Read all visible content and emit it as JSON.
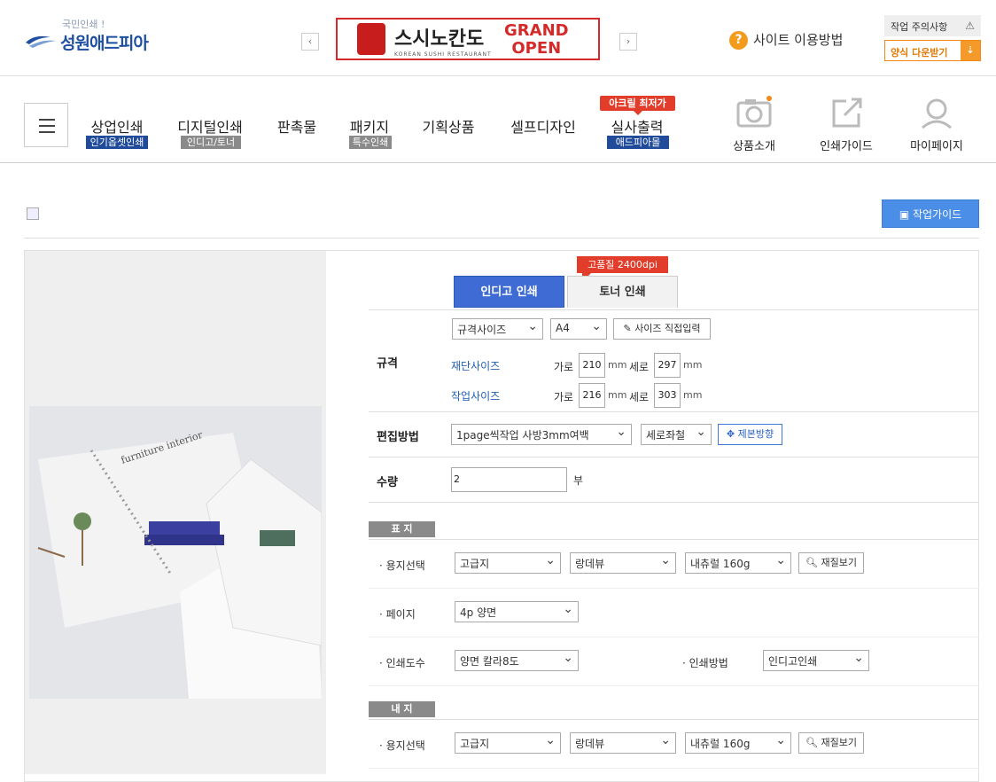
{
  "header": {
    "logo_small": "국민인쇄 !",
    "logo_main": "성원애드피아",
    "prev_label": "‹",
    "next_label": "›",
    "banner": {
      "title": "스시노칸도",
      "grand": "GRAND",
      "open": "OPEN",
      "sub": "KOREAN SUSHI RESTAURANT"
    },
    "help_icon": "?",
    "help_label": "사이트 이용방법",
    "warning_label": "작업 주의사항",
    "warning_icon": "⚠",
    "download_label": "양식 다운받기",
    "download_icon": "⇣"
  },
  "nav": {
    "items": [
      {
        "label": "상업인쇄",
        "sub": "인기옵셋인쇄"
      },
      {
        "label": "디지털인쇄",
        "sub": "인디고/토너"
      },
      {
        "label": "판촉물"
      },
      {
        "label": "패키지",
        "sub": "특수인쇄"
      },
      {
        "label": "기획상품"
      },
      {
        "label": "셀프디자인"
      },
      {
        "label": "실사출력",
        "sub": "애드피아몰"
      }
    ],
    "hot_badge": "아크릴 최저가",
    "right": [
      {
        "label": "상품소개",
        "icon": "camera-icon"
      },
      {
        "label": "인쇄가이드",
        "icon": "external-link-icon"
      },
      {
        "label": "마이페이지",
        "icon": "user-icon"
      }
    ]
  },
  "guide_button": "작업가이드",
  "tabs": {
    "badge": "고품질 2400dpi",
    "tab1": "인디고 인쇄",
    "tab2": "토너 인쇄"
  },
  "spec": {
    "label": "규격",
    "size_type": "규격사이즈",
    "size": "A4",
    "direct_input": "사이즈 직접입력",
    "cut_label": "재단사이즈",
    "work_label": "작업사이즈",
    "width_label": "가로",
    "height_label": "세로",
    "unit": "mm",
    "cut_w": "210",
    "cut_h": "297",
    "work_w": "216",
    "work_h": "303"
  },
  "edit": {
    "label": "편집방법",
    "method": "1page씩작업 사방3mm여백",
    "binding": "세로좌철",
    "binding_btn": "제본방향"
  },
  "qty": {
    "label": "수량",
    "value": "2",
    "unit": "부"
  },
  "cover": {
    "section": "표 지",
    "paper_label": "용지선택",
    "paper1": "고급지",
    "paper2": "랑데뷰",
    "paper3": "내츄럴 160g",
    "view_btn": "재질보기",
    "page_label": "페이지",
    "page_value": "4p 양면",
    "color_label": "인쇄도수",
    "color_value": "양면 칼라8도",
    "method_label": "인쇄방법",
    "method_value": "인디고인쇄"
  },
  "inner": {
    "section": "내 지",
    "paper_label": "용지선택",
    "paper1": "고급지",
    "paper2": "랑데뷰",
    "paper3": "내츄럴 160g",
    "view_btn": "재질보기"
  },
  "photo_text": "furniture interior"
}
